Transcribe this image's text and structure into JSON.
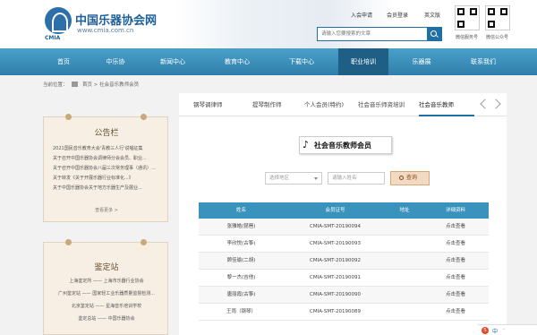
{
  "header": {
    "logo_cn": "中国乐器协会网",
    "logo_en": "www.cmia.com.cn",
    "logo_abbr": "CMIA",
    "top_links": [
      "入会申请",
      "会员登录",
      "英文版"
    ],
    "search": {
      "placeholder": "请输入您要搜索的文章"
    },
    "qr_codes": [
      {
        "label": "微信服务号",
        "icon": "qr-code-icon"
      },
      {
        "label": "微信公众号",
        "icon": "qr-code-icon"
      }
    ]
  },
  "nav": {
    "items": [
      "首页",
      "中乐协",
      "新闻中心",
      "教育中心",
      "下载中心",
      "职业培训",
      "乐器展",
      "联系我们"
    ],
    "active_index": 5,
    "colors": {
      "bar": "#2e7fab",
      "active": "#1f5f86"
    }
  },
  "breadcrumb": {
    "prefix": "当前位置：",
    "home": "首页",
    "sep": ">",
    "current": "社会音乐教师会员"
  },
  "notice": {
    "title": "公告栏",
    "items": [
      "2021国民音乐教育大会'青教三人行'说唱征集",
      "关于召开中国乐器协会调律师分会会员、职业...",
      "关于召开中国乐器协会八届三次常务理事（通讯）...",
      "关于转发《关于开展乐器行业标准化...》",
      "关于中国乐器协会关于地方乐器生产及展业..."
    ],
    "more": "查看更多 >"
  },
  "jianding": {
    "title": "鉴定站",
    "items": [
      "上海鉴定所 —— 上海市乐器行业协会",
      "广州鉴定站 —— 国家轻工业乐器质量监督检测...",
      "北京鉴定站 —— 星海音乐培训学校",
      "鉴定总站 —— 中国乐器协会"
    ]
  },
  "tabs": {
    "items": [
      "钢琴调律师",
      "提琴制作师",
      "个人会员(特约)",
      "社会音乐师资培训",
      "社会音乐教师"
    ],
    "active_index": 4
  },
  "section": {
    "icon": "music-note-icon",
    "title": "社会音乐教师会员"
  },
  "filters": {
    "region_placeholder": "选择地区",
    "name_placeholder": "请输入姓名",
    "query_label": "查询"
  },
  "table": {
    "headers": [
      "姓名",
      "会员证号",
      "地址",
      "详细资料"
    ],
    "rows": [
      [
        "张雅皓(琵琶)",
        "CMIA-SMT-20190094",
        "",
        "点击查看"
      ],
      [
        "李欣悦(古筝)",
        "CMIA-SMT-20190093",
        "",
        "点击查看"
      ],
      [
        "顾佳瑜(二胡)",
        "CMIA-SMT-20190092",
        "",
        "点击查看"
      ],
      [
        "黎一杰(吉他)",
        "CMIA-SMT-20190091",
        "",
        "点击查看"
      ],
      [
        "唐丽霞(古筝)",
        "CMIA-SMT-20190090",
        "",
        "点击查看"
      ],
      [
        "王雨（钢琴）",
        "CMIA-SMT-20190089",
        "",
        "点击查看"
      ]
    ]
  },
  "tray": {
    "items": [
      "S",
      "中",
      "·"
    ]
  }
}
